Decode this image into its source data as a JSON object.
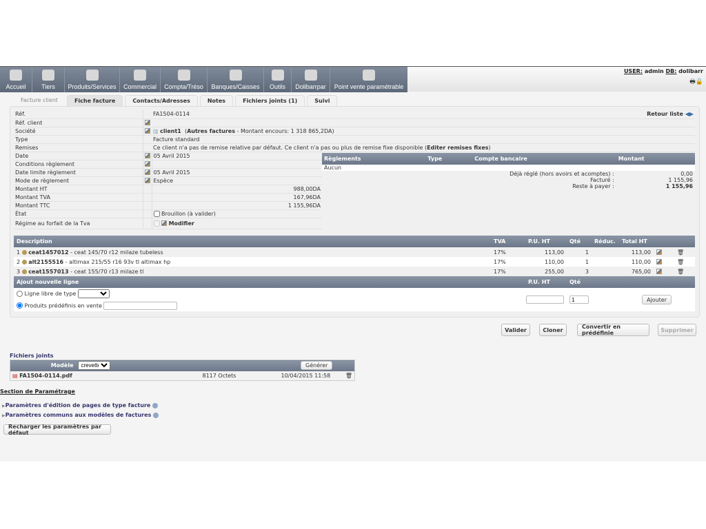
{
  "menu": [
    "Accueil",
    "Tiers",
    "Produits/Services",
    "Commercial",
    "Compta/Tréso",
    "Banques/Caisses",
    "Outils",
    "Dolibarrpar",
    "Point vente paramétrable"
  ],
  "user": {
    "user_label": "USER:",
    "user": "admin",
    "db_label": "DB:",
    "db": "dolibarr"
  },
  "tabs": [
    "Facture client",
    "Fiche facture",
    "Contacts/Adresses",
    "Notes",
    "Fichiers joints (1)",
    "Suivi"
  ],
  "retour": "Retour liste",
  "info": {
    "ref_l": "Réf.",
    "ref": "FA1504-0114",
    "refclient_l": "Réf. client",
    "societe_l": "Société",
    "client": "client1",
    "autres": "Autres factures",
    "encours": " - Montant encours: 1 318 865,2DA)",
    "open_paren": "(",
    "type_l": "Type",
    "type": "Facture standard",
    "remises_l": "Remises",
    "remises": "Ce client n'a pas de remise relative par défaut. Ce client n'a pas ou plus de remise fixe disponible (",
    "remises_link": "Editer remises fixes",
    "close_paren": ")",
    "date_l": "Date",
    "date": "05 Avril 2015",
    "cond_l": "Conditions règlement",
    "datelim_l": "Date limite règlement",
    "datelim": "05 Avril 2015",
    "mode_l": "Mode de règlement",
    "mode": "Espèce",
    "ht_l": "Montant HT",
    "ht": "988,00DA",
    "tva_l": "Montant TVA",
    "tva": "167,96DA",
    "ttc_l": "Montant TTC",
    "ttc": "1 155,96DA",
    "etat_l": "État",
    "etat": "Brouillon (à valider)",
    "regime_l": "Régime au forfait de la Tva",
    "modifier": "Modifier"
  },
  "payments": {
    "headers": [
      "Règlements",
      "Type",
      "Compte bancaire",
      "Montant"
    ],
    "none": "Aucun",
    "deja_l": "Déjà réglé (hors avoirs et acomptes) :",
    "deja": "0,00",
    "facture_l": "Facturé :",
    "facture": "1 155,96",
    "reste_l": "Reste à payer :",
    "reste": "1 155,96"
  },
  "lines": {
    "headers": [
      "Description",
      "TVA",
      "P.U. HT",
      "Qté",
      "Réduc.",
      "Total HT"
    ],
    "rows": [
      {
        "n": "1",
        "ref": "ceat1457012",
        "desc": " - ceat 145/70 r12 milaze tubeless",
        "tva": "17%",
        "pu": "113,00",
        "qty": "1",
        "total": "113,00"
      },
      {
        "n": "2",
        "ref": "alt2155516",
        "desc": " - altimax 215/55 r16 93v tl altimax hp",
        "tva": "17%",
        "pu": "110,00",
        "qty": "1",
        "total": "110,00"
      },
      {
        "n": "3",
        "ref": "ceat1557013",
        "desc": " - ceat 155/70 r13 milaze tl",
        "tva": "17%",
        "pu": "255,00",
        "qty": "3",
        "total": "765,00"
      }
    ],
    "add_title": "Ajout nouvelle ligne",
    "add_pu": "P.U. HT",
    "add_qty": "Qté",
    "free_line": "Ligne libre de type",
    "predef": "Produits prédéfinis en vente",
    "qty_value": "1",
    "add_btn": "Ajouter"
  },
  "actions": [
    "Valider",
    "Cloner",
    "Convertir en prédéfinie",
    "Supprimer"
  ],
  "files": {
    "title": "Fichiers joints",
    "model_l": "Modèle",
    "model": "crevette",
    "generate": "Générer",
    "name": "FA1504-0114.pdf",
    "size": "8117 Octets",
    "date": "10/04/2015 11:58"
  },
  "params": {
    "title": "Section de Paramétrage",
    "p1": "Paramètres d'édition de pages de type facture",
    "p2": "Paramètres communs aux modèles de factures",
    "reload": "Recharger les paramètres par défaut"
  }
}
